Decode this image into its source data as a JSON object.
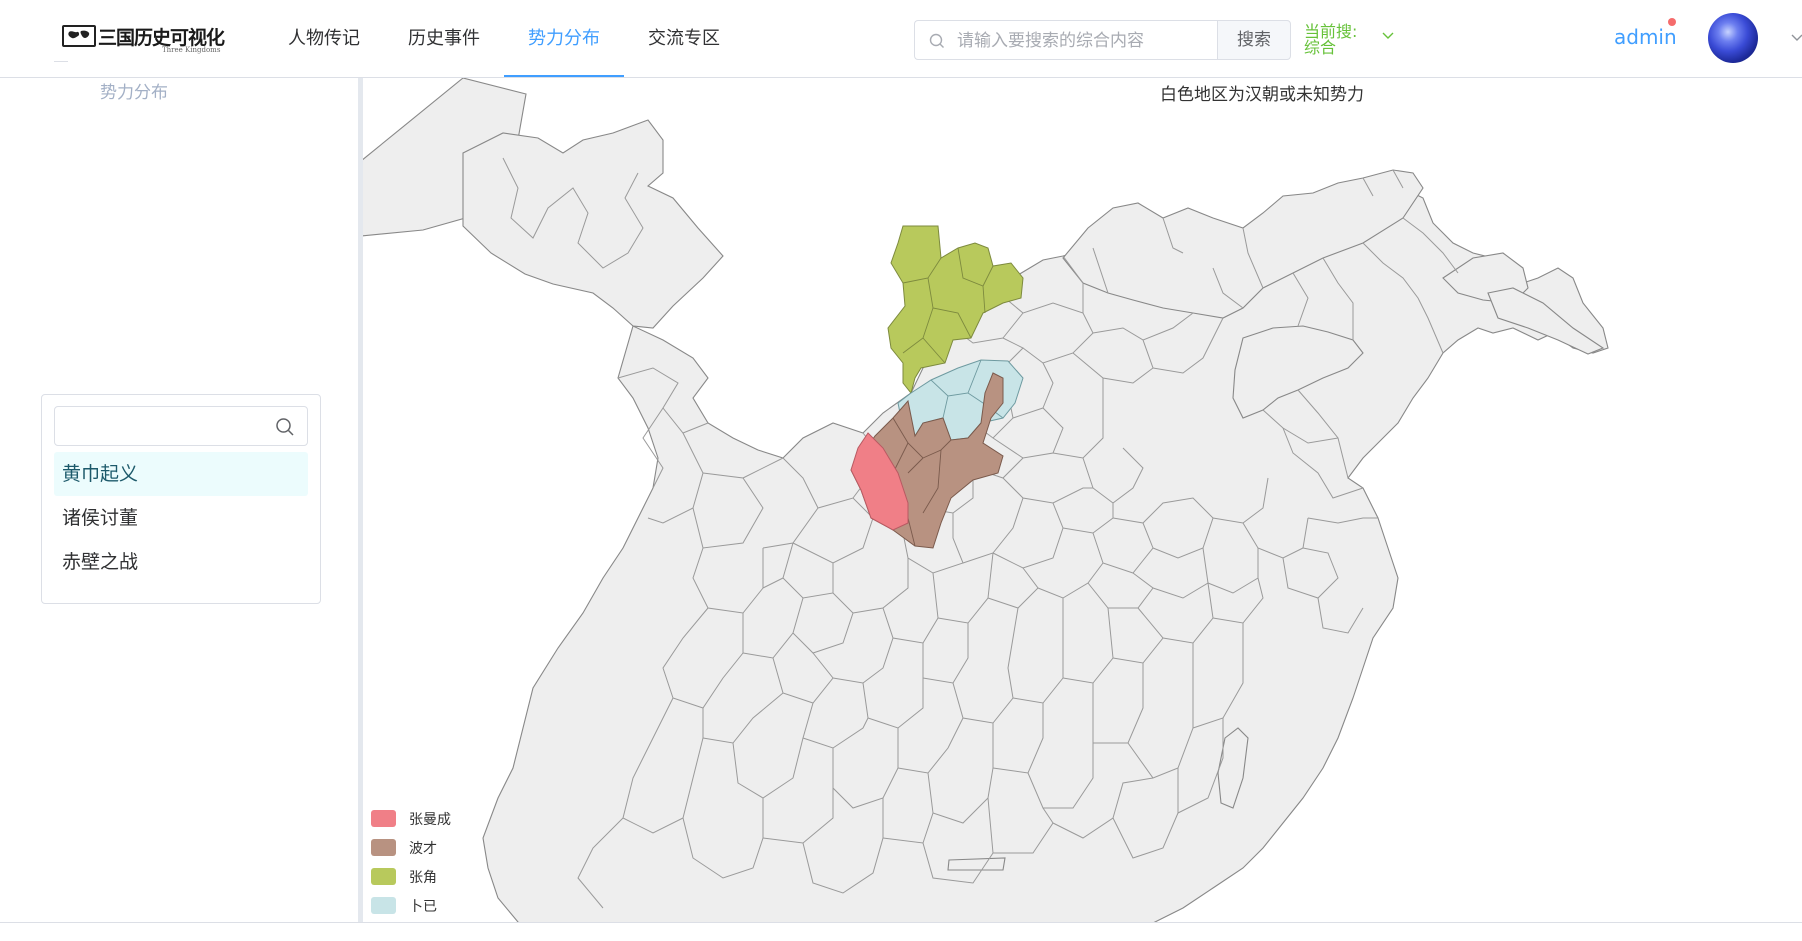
{
  "header": {
    "logo_text": "三国历史可视化",
    "logo_sub": "Three Kingdoms",
    "nav": [
      {
        "label": "人物传记",
        "active": false
      },
      {
        "label": "历史事件",
        "active": false
      },
      {
        "label": "势力分布",
        "active": true
      },
      {
        "label": "交流专区",
        "active": false
      }
    ],
    "search": {
      "placeholder": "请输入要搜索的综合内容",
      "button_label": "搜索"
    },
    "current_search_label": "当前搜:",
    "current_search_value": "综合",
    "user": {
      "name": "admin",
      "has_notification": true
    }
  },
  "sidebar": {
    "title": "势力分布",
    "filter_value": "",
    "events": [
      {
        "label": "黄巾起义",
        "active": true
      },
      {
        "label": "诸侯讨董",
        "active": false
      },
      {
        "label": "赤壁之战",
        "active": false
      }
    ]
  },
  "map": {
    "note": "白色地区为汉朝或未知势力",
    "base_color": "#eeeeee",
    "legend": [
      {
        "label": "张曼成",
        "color": "#f07f87"
      },
      {
        "label": "波才",
        "color": "#b89281"
      },
      {
        "label": "张角",
        "color": "#b8c95c"
      },
      {
        "label": "卜已",
        "color": "#c8e4e7"
      }
    ]
  },
  "colors": {
    "accent": "#409eff",
    "current_search": "#67c23a",
    "notification": "#f56c6c"
  }
}
